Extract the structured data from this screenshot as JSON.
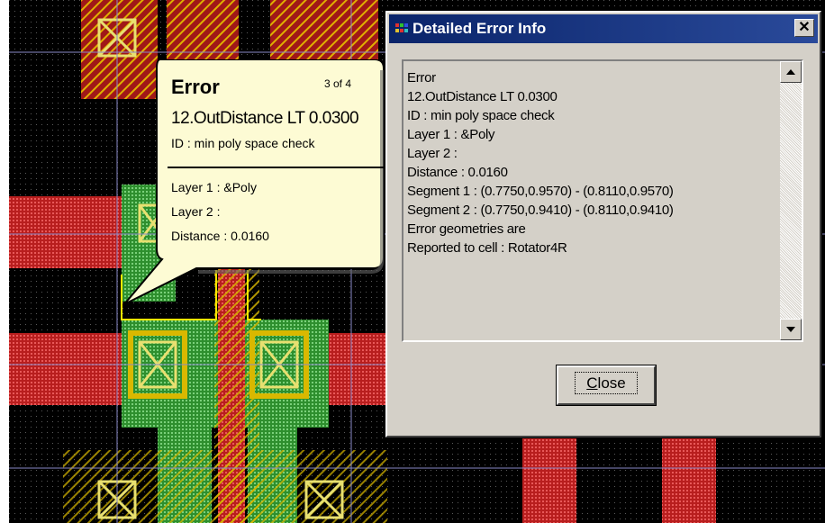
{
  "colors": {
    "background": "#000000",
    "poly": "#d52b2b",
    "diffusion": "#3fae3f",
    "metal": "#d9b800",
    "contact": "#e8e070",
    "gridline": "#8a8ac8",
    "callout_fill": "#fdfbd4",
    "dialog_face": "#d4d0c8",
    "titlebar": "#0a246a"
  },
  "callout": {
    "title": "Error",
    "counter": "3 of 4",
    "rule": "12.OutDistance LT 0.0300",
    "id_text": "ID : min poly space check",
    "layer1": "Layer 1 : &Poly",
    "layer2": "Layer 2 :",
    "distance": "Distance : 0.0160"
  },
  "dialog": {
    "title": "Detailed Error Info",
    "title_icon": "app-icon",
    "close_glyph": "✕",
    "lines": [
      "Error",
      "12.OutDistance LT 0.0300",
      "ID : min poly space check",
      "Layer 1 : &Poly",
      "Layer 2 :",
      "Distance : 0.0160",
      "Segment 1 : (0.7750,0.9570) - (0.8110,0.9570)",
      "Segment 2 : (0.7750,0.9410) - (0.8110,0.9410)",
      "Error geometries are",
      "Reported to cell : Rotator4R"
    ],
    "close_button_prefix": "C",
    "close_button_rest": "lose"
  }
}
